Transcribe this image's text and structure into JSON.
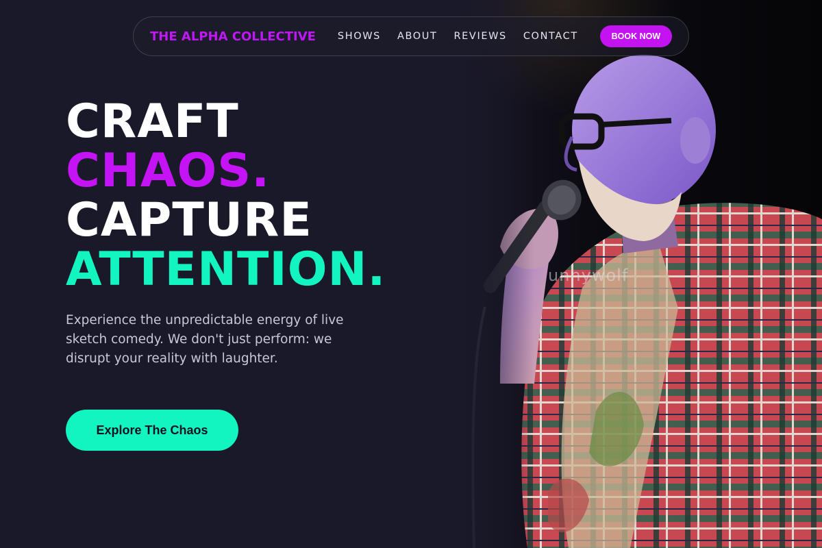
{
  "nav": {
    "brand": "THE ALPHA COLLECTIVE",
    "links": [
      "SHOWS",
      "ABOUT",
      "REVIEWS",
      "CONTACT"
    ],
    "book_label": "BOOK NOW"
  },
  "hero": {
    "lines": [
      "CRAFT",
      "CHAOS.",
      "CAPTURE",
      "ATTENTION."
    ],
    "subtext": "Experience the unpredictable energy of live sketch comedy. We don't just perform: we disrupt your reality with laughter.",
    "cta_label": "Explore The Chaos",
    "image_watermark": "unnywolf"
  },
  "colors": {
    "background": "#1a1929",
    "accent_purple": "#c413f5",
    "accent_teal": "#13f5c0"
  }
}
